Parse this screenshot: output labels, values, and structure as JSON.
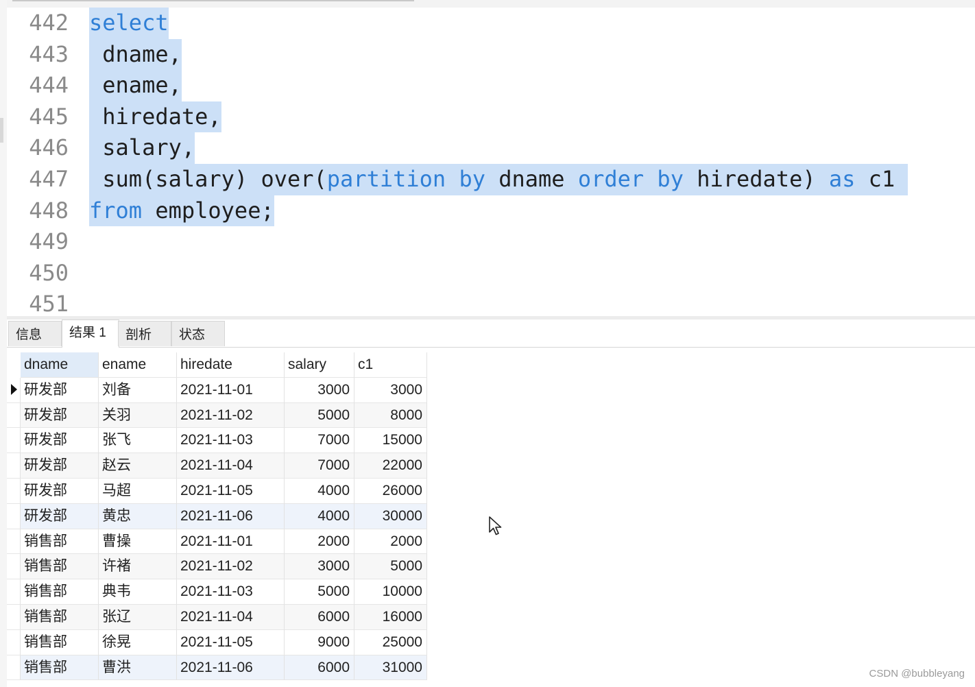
{
  "editor": {
    "lines": [
      {
        "num": "442",
        "parts": [
          {
            "t": "select",
            "kw": true
          }
        ]
      },
      {
        "num": "443",
        "parts": [
          {
            "t": " dname,",
            "kw": false
          }
        ]
      },
      {
        "num": "444",
        "parts": [
          {
            "t": " ename,",
            "kw": false
          }
        ]
      },
      {
        "num": "445",
        "parts": [
          {
            "t": " hiredate,",
            "kw": false
          }
        ]
      },
      {
        "num": "446",
        "parts": [
          {
            "t": " salary,",
            "kw": false
          }
        ]
      },
      {
        "num": "447",
        "parts": [
          {
            "t": " sum(salary) over(",
            "kw": false
          },
          {
            "t": "partition by",
            "kw": true
          },
          {
            "t": " dname ",
            "kw": false
          },
          {
            "t": "order by",
            "kw": true
          },
          {
            "t": " hiredate) ",
            "kw": false
          },
          {
            "t": "as",
            "kw": true
          },
          {
            "t": " c1 ",
            "kw": false
          }
        ]
      },
      {
        "num": "448",
        "parts": [
          {
            "t": "from",
            "kw": true
          },
          {
            "t": " employee;",
            "kw": false
          }
        ]
      },
      {
        "num": "449",
        "parts": []
      },
      {
        "num": "450",
        "parts": []
      },
      {
        "num": "451",
        "parts": []
      }
    ]
  },
  "tabs": [
    {
      "label": "信息",
      "active": false
    },
    {
      "label": "结果 1",
      "active": true
    },
    {
      "label": "剖析",
      "active": false
    },
    {
      "label": "状态",
      "active": false
    }
  ],
  "results": {
    "columns": [
      "dname",
      "ename",
      "hiredate",
      "salary",
      "c1"
    ],
    "rows": [
      [
        "研发部",
        "刘备",
        "2021-11-01",
        "3000",
        "3000"
      ],
      [
        "研发部",
        "关羽",
        "2021-11-02",
        "5000",
        "8000"
      ],
      [
        "研发部",
        "张飞",
        "2021-11-03",
        "7000",
        "15000"
      ],
      [
        "研发部",
        "赵云",
        "2021-11-04",
        "7000",
        "22000"
      ],
      [
        "研发部",
        "马超",
        "2021-11-05",
        "4000",
        "26000"
      ],
      [
        "研发部",
        "黄忠",
        "2021-11-06",
        "4000",
        "30000"
      ],
      [
        "销售部",
        "曹操",
        "2021-11-01",
        "2000",
        "2000"
      ],
      [
        "销售部",
        "许褚",
        "2021-11-02",
        "3000",
        "5000"
      ],
      [
        "销售部",
        "典韦",
        "2021-11-03",
        "5000",
        "10000"
      ],
      [
        "销售部",
        "张辽",
        "2021-11-04",
        "6000",
        "16000"
      ],
      [
        "销售部",
        "徐晃",
        "2021-11-05",
        "9000",
        "25000"
      ],
      [
        "销售部",
        "曹洪",
        "2021-11-06",
        "6000",
        "31000"
      ]
    ]
  },
  "watermark": "CSDN @bubbleyang"
}
